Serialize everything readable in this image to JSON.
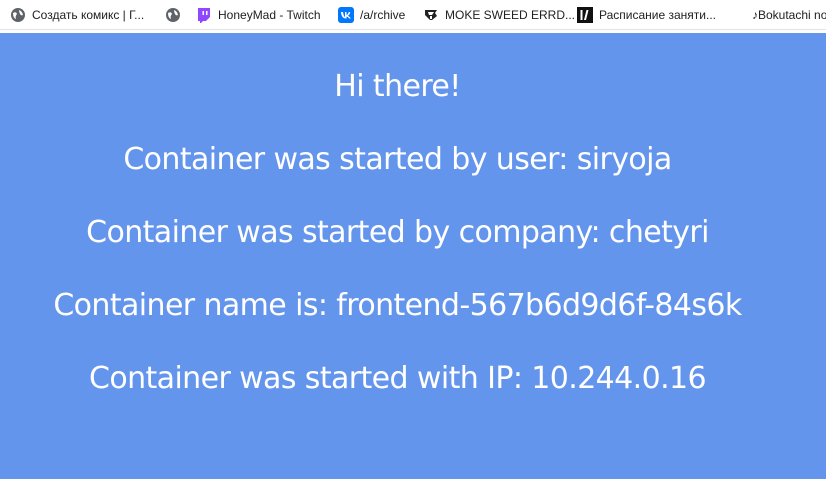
{
  "bookmarks": [
    {
      "label": "Создать комикс | Г...",
      "icon": "globe-icon"
    },
    {
      "label": "",
      "icon": "globe-icon"
    },
    {
      "label": "HoneyMad - Twitch",
      "icon": "twitch-icon"
    },
    {
      "label": "/a/rchive",
      "icon": "vk-icon"
    },
    {
      "label": "MOKE SWEED ERRD...",
      "icon": "fish-icon"
    },
    {
      "label": "Расписание заняти...",
      "icon": "schedule-icon"
    },
    {
      "label": "♪Bokutachi no",
      "icon": ""
    }
  ],
  "main": {
    "greeting": "Hi there!",
    "user_line": "Container was started by user: siryoja",
    "company_line": "Container was started by company: chetyri",
    "name_line": "Container name is: frontend-567b6d9d6f-84s6k",
    "ip_line": "Container was started with IP: 10.244.0.16"
  },
  "colors": {
    "background": "#6495ed",
    "text": "#ffffff"
  }
}
